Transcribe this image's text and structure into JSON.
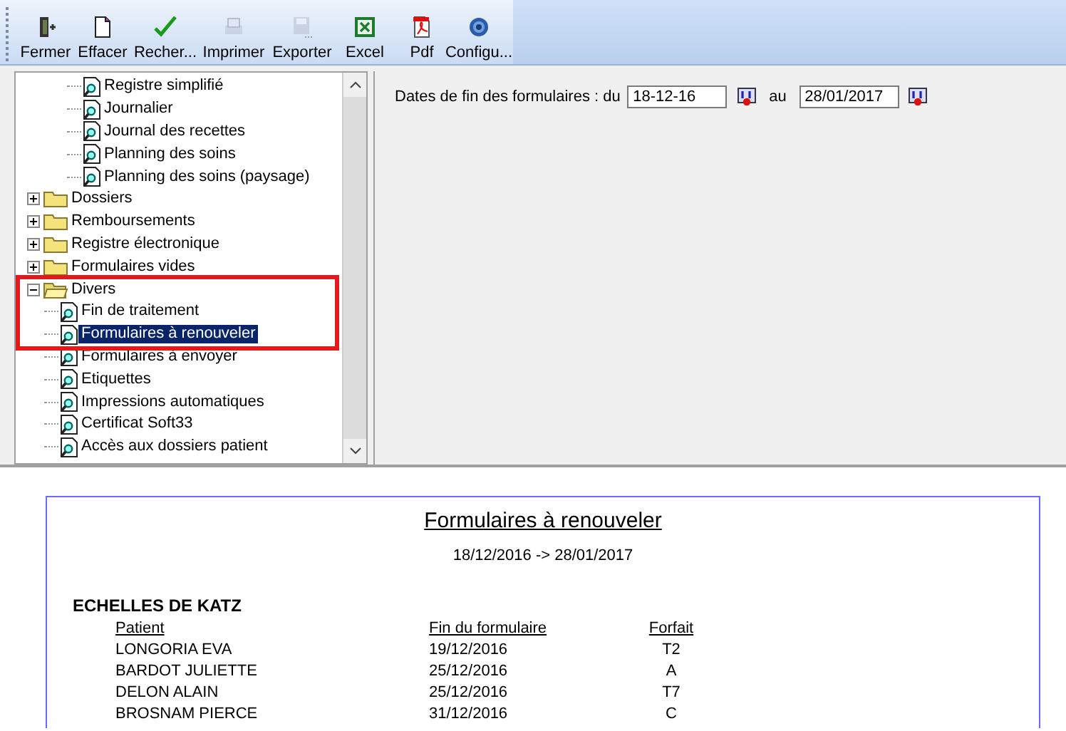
{
  "toolbar": [
    {
      "label": "Fermer",
      "kind": "exit",
      "disabled": false
    },
    {
      "label": "Effacer",
      "kind": "new",
      "disabled": false
    },
    {
      "label": "Recher...",
      "kind": "check",
      "disabled": false
    },
    {
      "label": "Imprimer",
      "kind": "print",
      "disabled": true
    },
    {
      "label": "Exporter",
      "kind": "save",
      "disabled": true
    },
    {
      "label": "Excel",
      "kind": "excel",
      "disabled": false
    },
    {
      "label": "Pdf",
      "kind": "pdf",
      "disabled": false
    },
    {
      "label": "Configu...",
      "kind": "gear",
      "disabled": false
    }
  ],
  "tree": {
    "items": [
      {
        "kind": "group",
        "children": [
          {
            "kind": "doc",
            "label": "Registre simplifié",
            "selected": false
          },
          {
            "kind": "doc",
            "label": "Journalier",
            "selected": false
          },
          {
            "kind": "doc",
            "label": "Journal des recettes",
            "selected": false
          },
          {
            "kind": "doc",
            "label": "Planning des soins",
            "selected": false
          },
          {
            "kind": "doc",
            "label": "Planning des soins (paysage)",
            "selected": false
          }
        ]
      },
      {
        "kind": "folder",
        "label": "Dossiers",
        "expanded": false
      },
      {
        "kind": "folder",
        "label": "Remboursements",
        "expanded": false
      },
      {
        "kind": "folder",
        "label": "Registre électronique",
        "expanded": false
      },
      {
        "kind": "folder",
        "label": "Formulaires vides",
        "expanded": false
      },
      {
        "kind": "folder",
        "label": "Divers",
        "expanded": true,
        "children": [
          {
            "kind": "doc",
            "label": "Fin de traitement",
            "selected": false
          },
          {
            "kind": "doc",
            "label": "Formulaires à renouveler",
            "selected": true
          },
          {
            "kind": "doc",
            "label": "Formulaires à envoyer",
            "selected": false
          },
          {
            "kind": "doc",
            "label": "Etiquettes",
            "selected": false
          },
          {
            "kind": "doc",
            "label": "Impressions automatiques",
            "selected": false
          },
          {
            "kind": "doc",
            "label": "Certificat Soft33",
            "selected": false
          },
          {
            "kind": "doc",
            "label": "Accès aux dossiers patient",
            "selected": false
          }
        ]
      }
    ]
  },
  "filter": {
    "label": "Dates de fin des formulaires : du",
    "from": "18-12-16",
    "between": "au",
    "to": "28/01/2017"
  },
  "report": {
    "title": "Formulaires à renouveler",
    "period": "18/12/2016 -> 28/01/2017",
    "section": "ECHELLES DE KATZ",
    "columns": [
      "Patient",
      "Fin du formulaire",
      "Forfait"
    ],
    "rows": [
      [
        "LONGORIA EVA",
        "19/12/2016",
        "T2"
      ],
      [
        "BARDOT JULIETTE",
        "25/12/2016",
        "A"
      ],
      [
        "DELON ALAIN",
        "25/12/2016",
        "T7"
      ],
      [
        "BROSNAM PIERCE",
        "31/12/2016",
        "C"
      ]
    ]
  }
}
